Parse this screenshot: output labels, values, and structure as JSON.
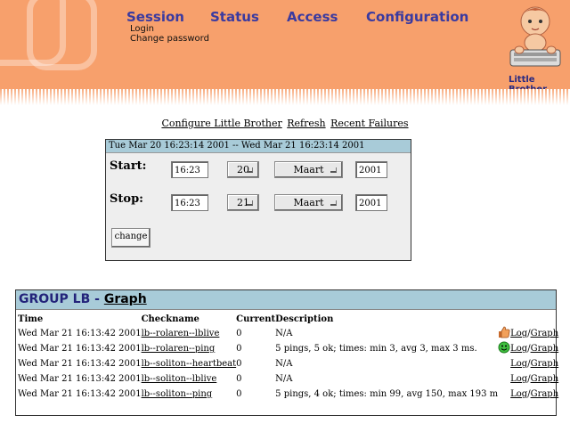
{
  "header": {
    "nav": [
      "Session",
      "Status",
      "Access",
      "Configuration"
    ],
    "session_menu": [
      "Login",
      "Change password"
    ],
    "brand": "Little Brother"
  },
  "toplinks": [
    "Configure Little Brother",
    "Refresh",
    "Recent Failures"
  ],
  "timeform": {
    "range": "Tue Mar 20 16:23:14 2001 -- Wed Mar 21 16:23:14 2001",
    "start_label": "Start:",
    "stop_label": "Stop:",
    "start": {
      "time": "16:23",
      "day": "20",
      "month": "Maart",
      "year": "2001"
    },
    "stop": {
      "time": "16:23",
      "day": "21",
      "month": "Maart",
      "year": "2001"
    },
    "change_button": "change"
  },
  "group": {
    "title": "GROUP LB -",
    "graph_link": "Graph",
    "columns": [
      "Time",
      "Checkname",
      "Current",
      "Description"
    ],
    "rows": [
      {
        "time": "Wed Mar 21 16:13:42 2001",
        "check": "lb--rolaren--lblive",
        "current": "0",
        "desc": "N/A",
        "icon": "thumbs-up-icon",
        "log": "Log",
        "graph": "Graph"
      },
      {
        "time": "Wed Mar 21 16:13:42 2001",
        "check": "lb--rolaren--ping",
        "current": "0",
        "desc": "5 pings, 5 ok; times: min 3, avg 3, max 3 ms.",
        "icon": "smiley-icon",
        "log": "Log",
        "graph": "Graph"
      },
      {
        "time": "Wed Mar 21 16:13:42 2001",
        "check": "lb--soliton--heartbeat",
        "current": "0",
        "desc": "N/A",
        "icon": "",
        "log": "Log",
        "graph": "Graph"
      },
      {
        "time": "Wed Mar 21 16:13:42 2001",
        "check": "lb--soliton--lblive",
        "current": "0",
        "desc": "N/A",
        "icon": "",
        "log": "Log",
        "graph": "Graph"
      },
      {
        "time": "Wed Mar 21 16:13:42 2001",
        "check": "lb--soliton--ping",
        "current": "0",
        "desc": "5 pings, 4 ok; times: min 99, avg 150, max 193 m",
        "icon": "",
        "log": "Log",
        "graph": "Graph"
      }
    ],
    "separator": "/"
  },
  "colors": {
    "header_bg": "#f7a06c",
    "nav": "#3a3aa0",
    "table_header": "#a8cbd8"
  }
}
